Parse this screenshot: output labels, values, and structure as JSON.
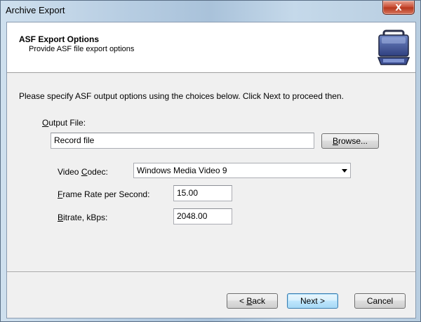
{
  "window": {
    "title": "Archive Export",
    "close_label": "X"
  },
  "header": {
    "title": "ASF Export Options",
    "subtitle": "Provide ASF file export options",
    "icon": "briefcase-icon"
  },
  "instruction": "Please specify ASF output options using the choices below. Click Next to proceed then.",
  "output_file": {
    "label_underlined": "O",
    "label_rest": "utput File:",
    "value": "Record file",
    "browse_underlined": "B",
    "browse_rest": "rowse..."
  },
  "video_codec": {
    "label_pre": "Video ",
    "label_underlined": "C",
    "label_rest": "odec:",
    "selected": "Windows Media Video 9"
  },
  "frame_rate": {
    "label_underlined": "F",
    "label_rest": "rame Rate per Second:",
    "value": "15.00"
  },
  "bitrate": {
    "label_underlined": "B",
    "label_rest": "itrate, kBps:",
    "value": "2048.00"
  },
  "buttons": {
    "back_pre": "< ",
    "back_underlined": "B",
    "back_rest": "ack",
    "next": "Next >",
    "cancel": "Cancel"
  },
  "colors": {
    "title_bar": "#b7cde2",
    "close_button": "#c7492f",
    "dialog_background": "#f0f0f0",
    "default_button_border": "#3c7fb1"
  }
}
